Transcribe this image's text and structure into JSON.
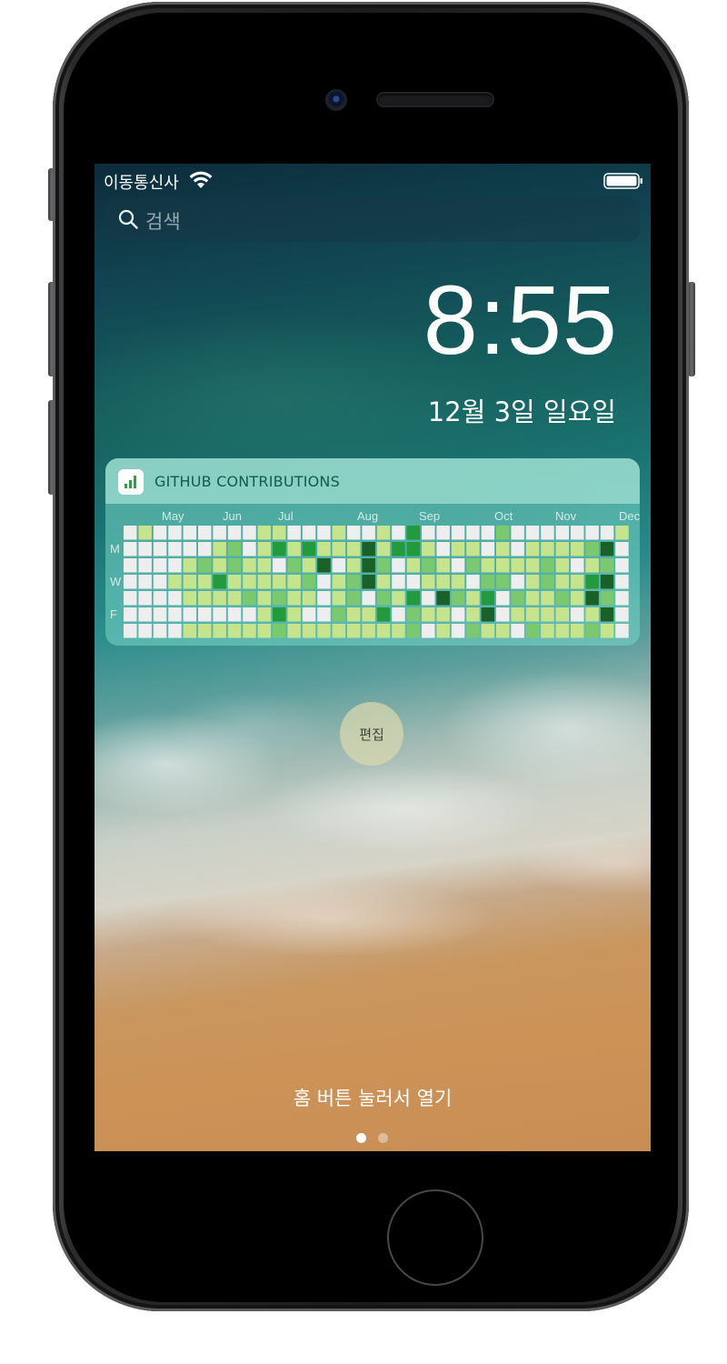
{
  "status_bar": {
    "carrier": "이동통신사"
  },
  "search": {
    "placeholder": "검색"
  },
  "lock_screen": {
    "time": "8:55",
    "date": "12월 3일 일요일"
  },
  "widget": {
    "title": "GITHUB CONTRIBUTIONS",
    "months": [
      "May",
      "Jun",
      "Jul",
      "Aug",
      "Sep",
      "Oct",
      "Nov",
      "Dec"
    ],
    "day_labels": [
      "",
      "M",
      "",
      "W",
      "",
      "F",
      ""
    ],
    "colors": [
      "#eeeeee",
      "#c6e48b",
      "#7bc96f",
      "#239a3b",
      "#196127"
    ],
    "weeks": [
      [
        0,
        0,
        0,
        0,
        0,
        0,
        0
      ],
      [
        1,
        0,
        0,
        0,
        0,
        0,
        0
      ],
      [
        0,
        0,
        0,
        0,
        0,
        0,
        0
      ],
      [
        0,
        0,
        0,
        1,
        0,
        0,
        0
      ],
      [
        0,
        0,
        1,
        1,
        1,
        0,
        1
      ],
      [
        0,
        0,
        2,
        1,
        1,
        0,
        1
      ],
      [
        0,
        1,
        1,
        3,
        1,
        0,
        1
      ],
      [
        0,
        2,
        2,
        1,
        1,
        0,
        1
      ],
      [
        0,
        0,
        1,
        1,
        2,
        0,
        1
      ],
      [
        1,
        1,
        1,
        1,
        1,
        1,
        1
      ],
      [
        1,
        3,
        0,
        1,
        2,
        3,
        2
      ],
      [
        0,
        1,
        2,
        1,
        1,
        1,
        1
      ],
      [
        0,
        3,
        1,
        2,
        1,
        0,
        1
      ],
      [
        0,
        1,
        4,
        0,
        0,
        0,
        1
      ],
      [
        1,
        1,
        0,
        1,
        1,
        2,
        1
      ],
      [
        0,
        1,
        1,
        2,
        2,
        1,
        1
      ],
      [
        0,
        4,
        4,
        4,
        0,
        1,
        1
      ],
      [
        1,
        1,
        2,
        1,
        2,
        3,
        1
      ],
      [
        0,
        3,
        0,
        0,
        1,
        0,
        1
      ],
      [
        3,
        3,
        1,
        0,
        3,
        2,
        2
      ],
      [
        0,
        1,
        2,
        1,
        0,
        1,
        0
      ],
      [
        0,
        0,
        1,
        1,
        4,
        1,
        1
      ],
      [
        0,
        1,
        0,
        1,
        2,
        0,
        0
      ],
      [
        0,
        1,
        2,
        0,
        1,
        1,
        2
      ],
      [
        0,
        0,
        1,
        2,
        3,
        4,
        1
      ],
      [
        2,
        1,
        1,
        2,
        0,
        0,
        1
      ],
      [
        0,
        0,
        1,
        0,
        2,
        1,
        0
      ],
      [
        0,
        1,
        1,
        1,
        1,
        1,
        2
      ],
      [
        0,
        1,
        2,
        2,
        1,
        1,
        1
      ],
      [
        0,
        1,
        1,
        1,
        2,
        1,
        1
      ],
      [
        0,
        1,
        0,
        1,
        1,
        0,
        1
      ],
      [
        0,
        2,
        1,
        3,
        4,
        1,
        2
      ],
      [
        0,
        4,
        2,
        4,
        2,
        4,
        1
      ],
      [
        1,
        0,
        0,
        0,
        0,
        0,
        0
      ]
    ]
  },
  "edit": {
    "label": "편집"
  },
  "unlock_hint": "홈 버튼 눌러서 열기"
}
